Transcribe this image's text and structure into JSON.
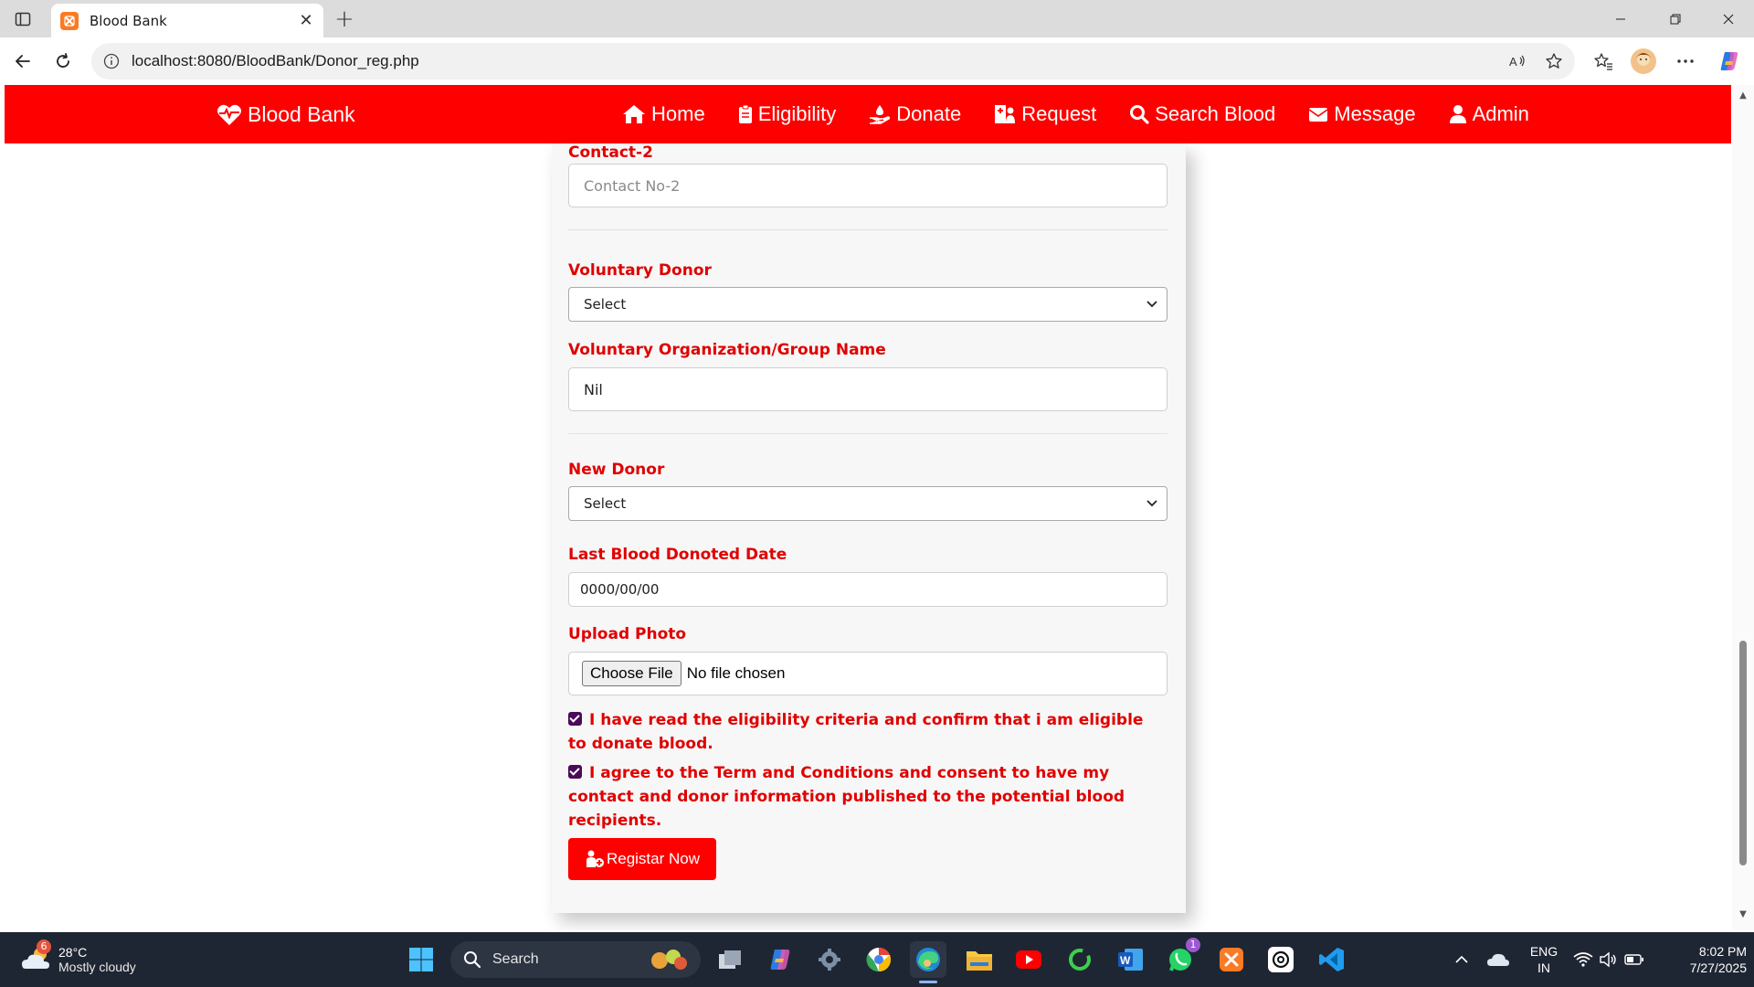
{
  "browser": {
    "tab_title": "Blood Bank",
    "url": "localhost:8080/BloodBank/Donor_reg.php"
  },
  "site": {
    "brand": "Blood Bank",
    "nav": [
      {
        "label": "Home",
        "icon": "home-icon"
      },
      {
        "label": "Eligibility",
        "icon": "clipboard-icon"
      },
      {
        "label": "Donate",
        "icon": "hand-donate-icon"
      },
      {
        "label": "Request",
        "icon": "hospital-user-icon"
      },
      {
        "label": "Search Blood",
        "icon": "search-icon"
      },
      {
        "label": "Message",
        "icon": "envelope-icon"
      },
      {
        "label": "Admin",
        "icon": "user-icon"
      }
    ],
    "colors": {
      "primary": "#fe0000",
      "label": "#e00000",
      "checkbox": "#4b0a59"
    }
  },
  "form": {
    "contact2": {
      "label": "Contact-2",
      "placeholder": "Contact No-2"
    },
    "voluntary_donor": {
      "label": "Voluntary Donor",
      "value": "Select"
    },
    "voluntary_org": {
      "label": "Voluntary Organization/Group Name",
      "value": "Nil"
    },
    "new_donor": {
      "label": "New Donor",
      "value": "Select"
    },
    "last_donated": {
      "label": "Last Blood Donoted Date",
      "value": "0000/00/00"
    },
    "upload_photo": {
      "label": "Upload Photo",
      "button": "Choose File",
      "status": "No file chosen"
    },
    "check_eligibility": {
      "checked": true,
      "text": "I have read the eligibility criteria and confirm that i am eligible to donate blood."
    },
    "check_terms": {
      "checked": true,
      "text": "I agree to the Term and Conditions and consent to have my contact and donor information published to the potential blood recipients."
    },
    "submit": "Registar Now"
  },
  "taskbar": {
    "weather_temp": "28°C",
    "weather_desc": "Mostly cloudy",
    "weather_badge": "6",
    "search_label": "Search",
    "whatsapp_badge": "1",
    "lang_top": "ENG",
    "lang_bottom": "IN",
    "time": "8:02 PM",
    "date": "7/27/2025"
  }
}
